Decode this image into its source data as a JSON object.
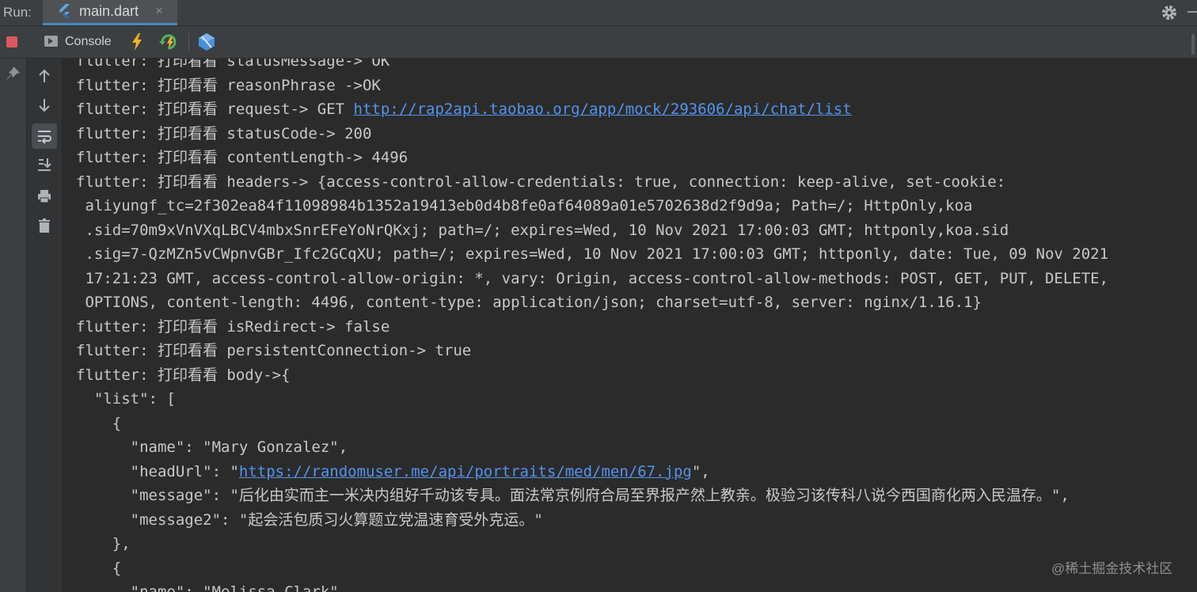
{
  "run_bar": {
    "label": "Run:",
    "tab_title": "main.dart",
    "tab_close": "×",
    "icons": [
      "flutter-icon",
      "close-icon",
      "gear-icon",
      "minimize-icon"
    ]
  },
  "toolbar": {
    "console_label": "Console",
    "icons": [
      "stop-icon",
      "console-icon",
      "hot-reload-icon",
      "hot-restart-icon",
      "devtools-icon"
    ]
  },
  "side_toolbar": {
    "icons": [
      "up-arrow-icon",
      "down-arrow-icon",
      "soft-wrap-icon",
      "scroll-to-end-icon",
      "print-icon",
      "trash-icon"
    ]
  },
  "console": {
    "lines": [
      {
        "text": "flutter: 打印看看 statusMessage-> OK",
        "link": ""
      },
      {
        "text": "flutter: 打印看看 reasonPhrase ->OK",
        "link": ""
      },
      {
        "text": "flutter: 打印看看 request-> GET ",
        "link": "http://rap2api.taobao.org/app/mock/293606/api/chat/list"
      },
      {
        "text": "flutter: 打印看看 statusCode-> 200",
        "link": ""
      },
      {
        "text": "flutter: 打印看看 contentLength-> 4496",
        "link": ""
      },
      {
        "text": "flutter: 打印看看 headers-> {access-control-allow-credentials: true, connection: keep-alive, set-cookie:",
        "link": ""
      },
      {
        "text": " aliyungf_tc=2f302ea84f11098984b1352a19413eb0d4b8fe0af64089a01e5702638d2f9d9a; Path=/; HttpOnly,koa",
        "link": ""
      },
      {
        "text": " .sid=70m9xVnVXqLBCV4mbxSnrEFeYoNrQKxj; path=/; expires=Wed, 10 Nov 2021 17:00:03 GMT; httponly,koa.sid",
        "link": ""
      },
      {
        "text": " .sig=7-QzMZn5vCWpnvGBr_Ifc2GCqXU; path=/; expires=Wed, 10 Nov 2021 17:00:03 GMT; httponly, date: Tue, 09 Nov 2021",
        "link": ""
      },
      {
        "text": " 17:21:23 GMT, access-control-allow-origin: *, vary: Origin, access-control-allow-methods: POST, GET, PUT, DELETE,",
        "link": ""
      },
      {
        "text": " OPTIONS, content-length: 4496, content-type: application/json; charset=utf-8, server: nginx/1.16.1}",
        "link": ""
      },
      {
        "text": "flutter: 打印看看 isRedirect-> false",
        "link": ""
      },
      {
        "text": "flutter: 打印看看 persistentConnection-> true",
        "link": ""
      },
      {
        "text": "flutter: 打印看看 body->{",
        "link": ""
      },
      {
        "text": "  \"list\": [",
        "link": ""
      },
      {
        "text": "    {",
        "link": ""
      },
      {
        "text": "      \"name\": \"Mary Gonzalez\",",
        "link": ""
      },
      {
        "text": "      \"headUrl\": \"",
        "link": "https://randomuser.me/api/portraits/med/men/67.jpg",
        "after": "\","
      },
      {
        "text": "      \"message\": \"后化由实而主一米决内组好千动该专具。面法常京例府合局至界报产然上教亲。极验习该传科八说今西国商化两入民温存。\",",
        "link": ""
      },
      {
        "text": "      \"message2\": \"起会活包质习火算题立党温速育受外克运。\"",
        "link": ""
      },
      {
        "text": "    },",
        "link": ""
      },
      {
        "text": "    {",
        "link": ""
      },
      {
        "text": "      \"name\": \"Melissa Clark\",",
        "link": ""
      }
    ]
  },
  "watermark": "@稀土掘金技术社区",
  "colors": {
    "background": "#2b2b2b",
    "text": "#c8c8c8",
    "link": "#5394ec",
    "stop": "#db5860",
    "tab_underline": "#4a88c7"
  }
}
